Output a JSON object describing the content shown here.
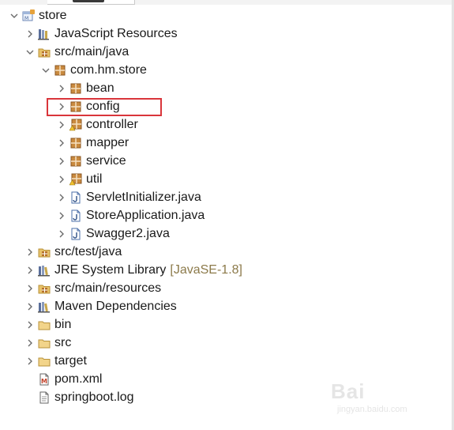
{
  "tree": {
    "items": [
      {
        "label": "store",
        "decor": "",
        "icon": "project-icon",
        "level": 0,
        "chevron": "expanded"
      },
      {
        "label": "JavaScript Resources",
        "decor": "",
        "icon": "javascript-resources-icon",
        "level": 1,
        "chevron": "collapsed"
      },
      {
        "label": "src/main/java",
        "decor": "",
        "icon": "source-folder-icon",
        "level": 1,
        "chevron": "expanded"
      },
      {
        "label": "com.hm.store",
        "decor": "",
        "icon": "package-icon",
        "level": 2,
        "chevron": "expanded"
      },
      {
        "label": "bean",
        "decor": "",
        "icon": "package-icon",
        "level": 3,
        "chevron": "collapsed"
      },
      {
        "label": "config",
        "decor": "",
        "icon": "package-icon",
        "level": 3,
        "chevron": "collapsed",
        "highlighted": true
      },
      {
        "label": "controller",
        "decor": "",
        "icon": "package-warning-icon",
        "level": 3,
        "chevron": "collapsed"
      },
      {
        "label": "mapper",
        "decor": "",
        "icon": "package-icon",
        "level": 3,
        "chevron": "collapsed"
      },
      {
        "label": "service",
        "decor": "",
        "icon": "package-icon",
        "level": 3,
        "chevron": "collapsed"
      },
      {
        "label": "util",
        "decor": "",
        "icon": "package-warning-icon",
        "level": 3,
        "chevron": "collapsed"
      },
      {
        "label": "ServletInitializer.java",
        "decor": "",
        "icon": "java-file-icon",
        "level": 3,
        "chevron": "collapsed"
      },
      {
        "label": "StoreApplication.java",
        "decor": "",
        "icon": "java-file-icon",
        "level": 3,
        "chevron": "collapsed"
      },
      {
        "label": "Swagger2.java",
        "decor": "",
        "icon": "java-file-icon",
        "level": 3,
        "chevron": "collapsed"
      },
      {
        "label": "src/test/java",
        "decor": "",
        "icon": "source-folder-icon",
        "level": 1,
        "chevron": "collapsed"
      },
      {
        "label": "JRE System Library",
        "decor": "[JavaSE-1.8]",
        "icon": "library-icon",
        "level": 1,
        "chevron": "collapsed"
      },
      {
        "label": "src/main/resources",
        "decor": "",
        "icon": "source-folder-icon",
        "level": 1,
        "chevron": "collapsed"
      },
      {
        "label": "Maven Dependencies",
        "decor": "",
        "icon": "library-icon",
        "level": 1,
        "chevron": "collapsed"
      },
      {
        "label": "bin",
        "decor": "",
        "icon": "folder-icon",
        "level": 1,
        "chevron": "collapsed"
      },
      {
        "label": "src",
        "decor": "",
        "icon": "folder-icon",
        "level": 1,
        "chevron": "collapsed"
      },
      {
        "label": "target",
        "decor": "",
        "icon": "folder-icon",
        "level": 1,
        "chevron": "collapsed"
      },
      {
        "label": "pom.xml",
        "decor": "",
        "icon": "xml-file-icon",
        "level": 1,
        "chevron": "none"
      },
      {
        "label": "springboot.log",
        "decor": "",
        "icon": "text-file-icon",
        "level": 1,
        "chevron": "none"
      }
    ]
  },
  "watermark": {
    "text": "Bai",
    "sub": "jingyan.baidu.com"
  },
  "colors": {
    "highlight": "#d9353b",
    "decoration": "#8c7a4a",
    "package": "#b5702a",
    "folder": "#e8c36a",
    "java": "#4b6fa8"
  }
}
